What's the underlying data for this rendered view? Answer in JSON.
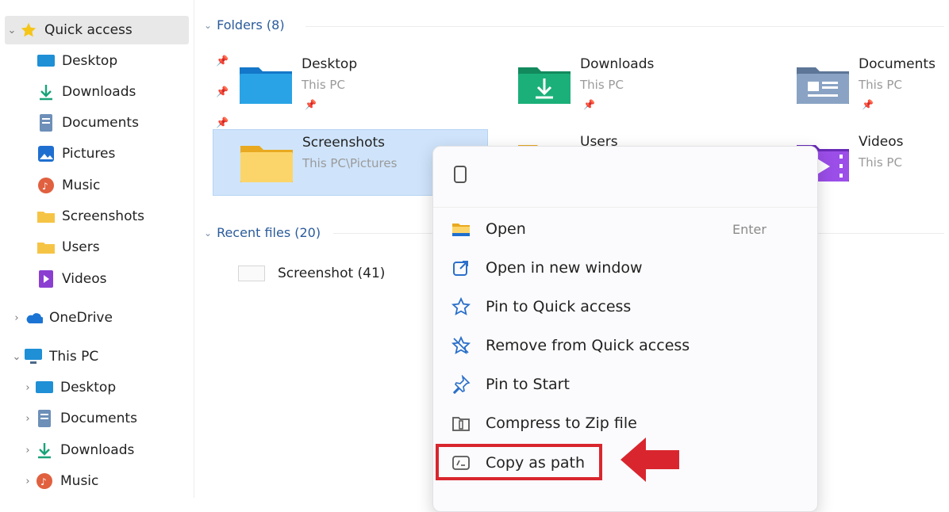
{
  "sidebar": {
    "quick_access": {
      "label": "Quick access"
    },
    "pinned": [
      {
        "label": "Desktop",
        "icon": "desktop-icon"
      },
      {
        "label": "Downloads",
        "icon": "downloads-icon"
      },
      {
        "label": "Documents",
        "icon": "documents-icon"
      },
      {
        "label": "Pictures",
        "icon": "pictures-icon"
      }
    ],
    "recent": [
      {
        "label": "Music",
        "icon": "music-icon"
      },
      {
        "label": "Screenshots",
        "icon": "folder-icon"
      },
      {
        "label": "Users",
        "icon": "folder-icon"
      },
      {
        "label": "Videos",
        "icon": "videos-icon"
      }
    ],
    "onedrive": {
      "label": "OneDrive"
    },
    "this_pc": {
      "label": "This PC"
    },
    "this_pc_items": [
      {
        "label": "Desktop",
        "icon": "desktop-icon"
      },
      {
        "label": "Documents",
        "icon": "documents-icon"
      },
      {
        "label": "Downloads",
        "icon": "downloads-icon"
      },
      {
        "label": "Music",
        "icon": "music-icon"
      }
    ]
  },
  "main": {
    "folders_header": "Folders (8)",
    "folders": [
      {
        "name": "Desktop",
        "location": "This PC",
        "pinned": true
      },
      {
        "name": "Downloads",
        "location": "This PC",
        "pinned": true
      },
      {
        "name": "Documents",
        "location": "This PC",
        "pinned": true
      },
      {
        "name": "Screenshots",
        "location": "This PC\\Pictures",
        "pinned": false
      },
      {
        "name": "Users",
        "location": "",
        "pinned": false
      },
      {
        "name": "Videos",
        "location": "This PC",
        "pinned": false
      }
    ],
    "recent_header": "Recent files (20)",
    "recent_files": [
      {
        "name": "Screenshot (41)"
      }
    ]
  },
  "context_menu": {
    "items": [
      {
        "label": "Open",
        "shortcut": "Enter",
        "icon": "open-folder-icon"
      },
      {
        "label": "Open in new window",
        "shortcut": "",
        "icon": "new-window-icon"
      },
      {
        "label": "Pin to Quick access",
        "shortcut": "",
        "icon": "star-icon"
      },
      {
        "label": "Remove from Quick access",
        "shortcut": "",
        "icon": "unstar-icon"
      },
      {
        "label": "Pin to Start",
        "shortcut": "",
        "icon": "pin-icon"
      },
      {
        "label": "Compress to Zip file",
        "shortcut": "",
        "icon": "zip-icon"
      },
      {
        "label": "Copy as path",
        "shortcut": "",
        "icon": "copy-path-icon"
      }
    ]
  },
  "colors": {
    "accent": "#2a5b9b",
    "selection": "#cfe4fb",
    "highlight": "#d9262e"
  }
}
